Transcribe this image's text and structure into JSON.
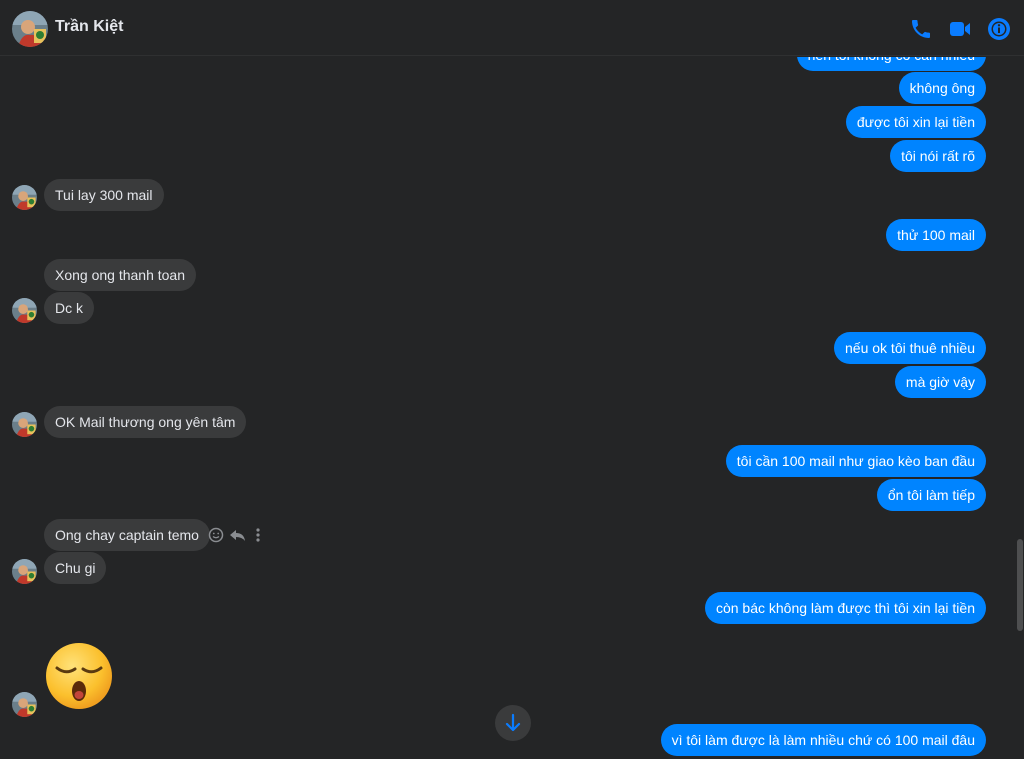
{
  "header": {
    "contact_name": "Trần Kiệt",
    "icons": [
      "avatar",
      "phone-icon",
      "video-call-icon",
      "info-icon"
    ],
    "accent_color": "#0084ff"
  },
  "messages": {
    "out_partial": "nên tôi không có cần nhiều",
    "out_1": "không ông",
    "out_2": "được tôi xin lại tiền",
    "out_3": "tôi nói rất rõ",
    "in_1": "Tui lay 300 mail",
    "out_4": "thử 100 mail",
    "in_2": "Xong ong thanh toan",
    "in_3": "Dc k",
    "out_5": "nếu ok tôi thuê nhiều",
    "out_6": "mà giờ vậy",
    "in_4": "OK Mail thương ong yên tâm",
    "out_7": "tôi cần 100 mail như giao kèo ban đầu",
    "out_8": "ổn tôi làm tiếp",
    "in_5": "Ong chay captain temo",
    "in_6": "Chu gi",
    "out_9": "còn bác không làm được thì tôi xin lại tiền",
    "out_10": "vì tôi làm được là làm nhiều chứ có 100 mail đâu",
    "emoji": "sleepy-face-emoji"
  },
  "message_actions": [
    "react-icon",
    "reply-icon",
    "more-icon"
  ],
  "scroll_down_icon": "arrow-down-icon",
  "colors": {
    "background": "#242526",
    "outgoing_bubble": "#0084ff",
    "incoming_bubble": "#3a3b3c"
  }
}
